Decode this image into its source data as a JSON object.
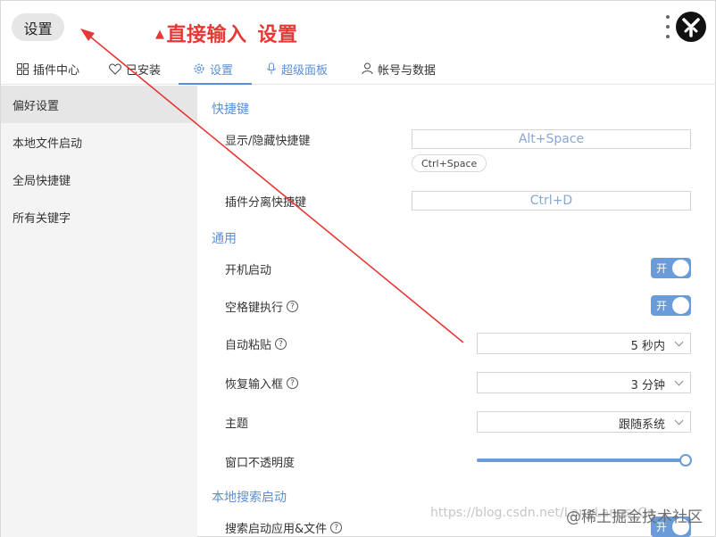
{
  "search": {
    "value": "设置"
  },
  "annotation": {
    "part1": "直接输入",
    "part2": "设置"
  },
  "tabs": [
    {
      "label": "插件中心",
      "icon": "grid-icon"
    },
    {
      "label": "已安装",
      "icon": "heart-icon"
    },
    {
      "label": "设置",
      "icon": "gear-icon"
    },
    {
      "label": "超级面板",
      "icon": "mic-icon"
    },
    {
      "label": "帐号与数据",
      "icon": "user-icon"
    }
  ],
  "sidebar": {
    "items": [
      {
        "label": "偏好设置"
      },
      {
        "label": "本地文件启动"
      },
      {
        "label": "全局快捷键"
      },
      {
        "label": "所有关键字"
      }
    ]
  },
  "sections": {
    "shortcuts": {
      "title": "快捷键",
      "toggle_label": "显示/隐藏快捷键",
      "toggle_value": "Alt+Space",
      "toggle_chip": "Ctrl+Space",
      "detach_label": "插件分离快捷键",
      "detach_value": "Ctrl+D"
    },
    "general": {
      "title": "通用",
      "autostart": {
        "label": "开机启动",
        "state": "开"
      },
      "space_exec": {
        "label": "空格键执行",
        "state": "开"
      },
      "auto_paste": {
        "label": "自动粘贴",
        "value": "5 秒内"
      },
      "restore_input": {
        "label": "恢复输入框",
        "value": "3 分钟"
      },
      "theme": {
        "label": "主题",
        "value": "跟随系统"
      },
      "opacity": {
        "label": "窗口不透明度",
        "level": 1.0
      }
    },
    "local_search": {
      "title": "本地搜索启动",
      "search_apps": {
        "label": "搜索启动应用&文件",
        "state": "开"
      }
    }
  },
  "watermark": {
    "url": "https://blog.csdn.net/LangLangs_Ga",
    "brand": "@稀土掘金技术社区"
  },
  "colors": {
    "accent": "#5a8fd6",
    "annotation": "#e53935",
    "toggle": "#6b9bd8"
  }
}
